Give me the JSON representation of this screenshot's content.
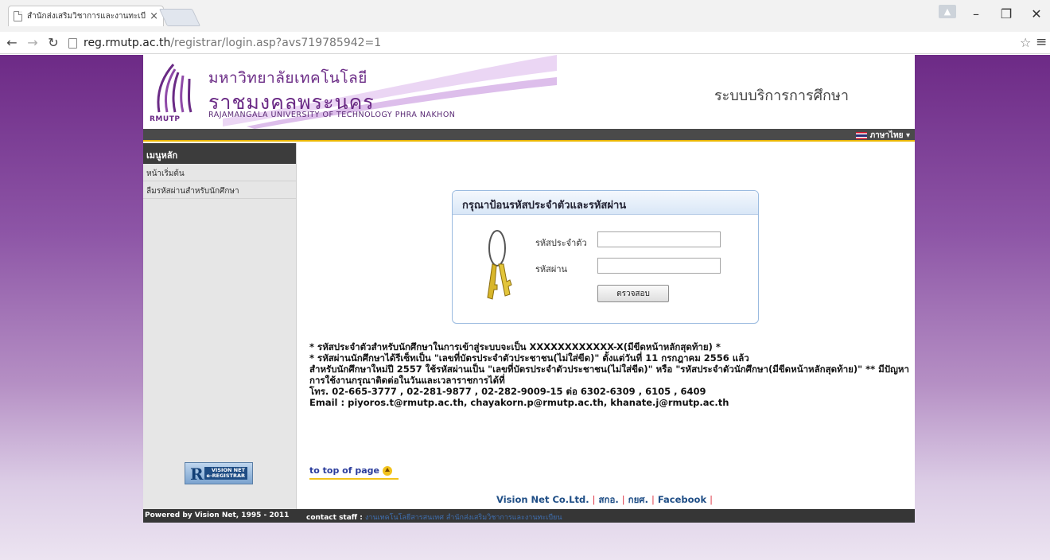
{
  "browser": {
    "tab_title": "สำนักส่งเสริมวิชาการและงานทะเบียน",
    "tab_close": "×",
    "url_host": "reg.rmutp.ac.th",
    "url_path": "/registrar/login.asp?avs719785942=1",
    "minimize": "–",
    "restore": "❐",
    "close": "✕"
  },
  "header": {
    "logo_th_line1": "มหาวิทยาลัยเทคโนโลยี",
    "logo_th_line2": "ราชมงคลพระนคร",
    "logo_en": "RAJAMANGALA UNIVERSITY   OF TECHNOLOGY PHRA NAKHON",
    "logo_abbr": "RMUTP",
    "system_title": "ระบบบริการการศึกษา",
    "language": "ภาษาไทย ▾"
  },
  "sidebar": {
    "heading": "เมนูหลัก",
    "items": [
      {
        "label": "หน้าเริ่มต้น"
      },
      {
        "label": "ลืมรหัสผ่านสำหรับนักศึกษา"
      }
    ],
    "badge_text_1": "VISION NET",
    "badge_text_2": "e-REGISTRAR"
  },
  "login": {
    "heading": "กรุณาป้อนรหัสประจำตัวและรหัสผ่าน",
    "user_label": "รหัสประจำตัว",
    "user_value": "",
    "pass_label": "รหัสผ่าน",
    "pass_value": "",
    "submit_label": "ตรวจสอบ"
  },
  "notes": [
    "* รหัสประจำตัวสำหรับนักศึกษาในการเข้าสู่ระบบจะเป็น XXXXXXXXXXXX-X(มีขีดหน้าหลักสุดท้าย) *",
    "* รหัสผ่านนักศึกษาได้รีเซ็ทเป็น \"เลขที่บัตรประจำตัวประชาชน(ไม่ใส่ขีด)\" ตั้งแต่วันที่ 11 กรกฎาคม 2556 แล้ว",
    "สำหรับนักศึกษาใหม่ปี 2557 ใช้รหัสผ่านเป็น \"เลขที่บัตรประจำตัวประชาชน(ไม่ใส่ขีด)\" หรือ \"รหัสประจำตัวนักศึกษา(มีขีดหน้าหลักสุดท้าย)\" ** มีปัญหาการใช้งานกรุณาติดต่อในวันและเวลาราชการได้ที่",
    "โทร. 02-665-3777 , 02-281-9877 , 02-282-9009-15 ต่อ 6302-6309 , 6105 , 6409",
    "Email : piyoros.t@rmutp.ac.th, chayakorn.p@rmutp.ac.th, khanate.j@rmutp.ac.th"
  ],
  "to_top": "to top of page",
  "footer_links": [
    "Vision Net Co.Ltd.",
    "สกอ.",
    "กยศ.",
    "Facebook"
  ],
  "footbar": {
    "powered": "Powered by Vision Net, 1995 - 2011",
    "contact_label": "contact staff :",
    "contact_link": "งานเทคโนโลยีสารสนเทศ สำนักส่งเสริมวิชาการและงานทะเบียน"
  }
}
